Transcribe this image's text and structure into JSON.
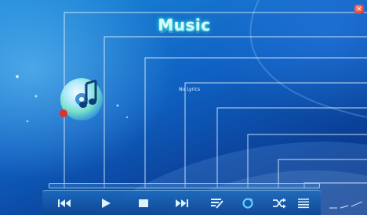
{
  "app": {
    "title": "Music",
    "close_glyph": "×"
  },
  "lyrics": {
    "status_text": "No Lyrics"
  },
  "controls": [
    {
      "icon": "skip-previous-icon"
    },
    {
      "icon": "play-icon"
    },
    {
      "icon": "stop-icon"
    },
    {
      "icon": "skip-next-icon"
    },
    {
      "icon": "playlist-edit-icon"
    },
    {
      "icon": "repeat-icon"
    },
    {
      "icon": "shuffle-icon"
    },
    {
      "icon": "playlist-icon"
    }
  ],
  "colors": {
    "accent": "#3ff0d8",
    "background": "#1266c8",
    "logo_red": "#e0302a"
  }
}
